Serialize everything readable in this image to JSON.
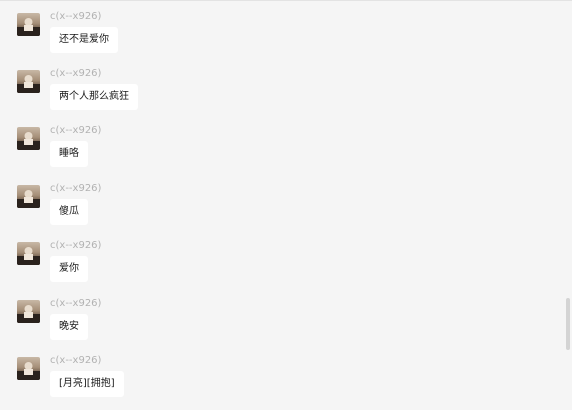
{
  "messages": [
    {
      "sender": "c(x--x926)",
      "text": "还不是爱你",
      "avatar": "profile-photo"
    },
    {
      "sender": "c(x--x926)",
      "text": "两个人那么疯狂",
      "avatar": "profile-photo"
    },
    {
      "sender": "c(x--x926)",
      "text": "睡咯",
      "avatar": "profile-photo"
    },
    {
      "sender": "c(x--x926)",
      "text": "傻瓜",
      "avatar": "profile-photo"
    },
    {
      "sender": "c(x--x926)",
      "text": "爱你",
      "avatar": "profile-photo"
    },
    {
      "sender": "c(x--x926)",
      "text": "晚安",
      "avatar": "profile-photo"
    },
    {
      "sender": "c(x--x926)",
      "text": "[月亮][拥抱]",
      "avatar": "profile-photo"
    }
  ],
  "colors": {
    "background": "#f5f5f5",
    "bubble": "#ffffff",
    "sender_name": "#b2b2b2",
    "message_text": "#1a1a1a"
  }
}
